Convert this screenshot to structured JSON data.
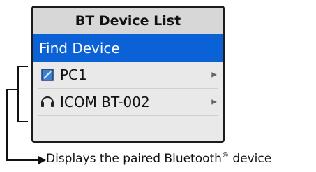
{
  "screen": {
    "title": "BT Device List",
    "items": [
      {
        "label": "Find Device",
        "selected": true
      },
      {
        "label": "PC1",
        "icon": "pc-icon",
        "has_arrow": true
      },
      {
        "label": "ICOM BT-002",
        "icon": "headset-icon",
        "has_arrow": true
      }
    ]
  },
  "caption": {
    "text_before": "Displays the paired Bluetooth",
    "superscript": "®",
    "text_after": " device"
  },
  "colors": {
    "selected_bg": "#0b61d6",
    "screen_bg": "#e9e9e9",
    "title_bg": "#d7d7d7",
    "frame": "#1c1c1c"
  }
}
